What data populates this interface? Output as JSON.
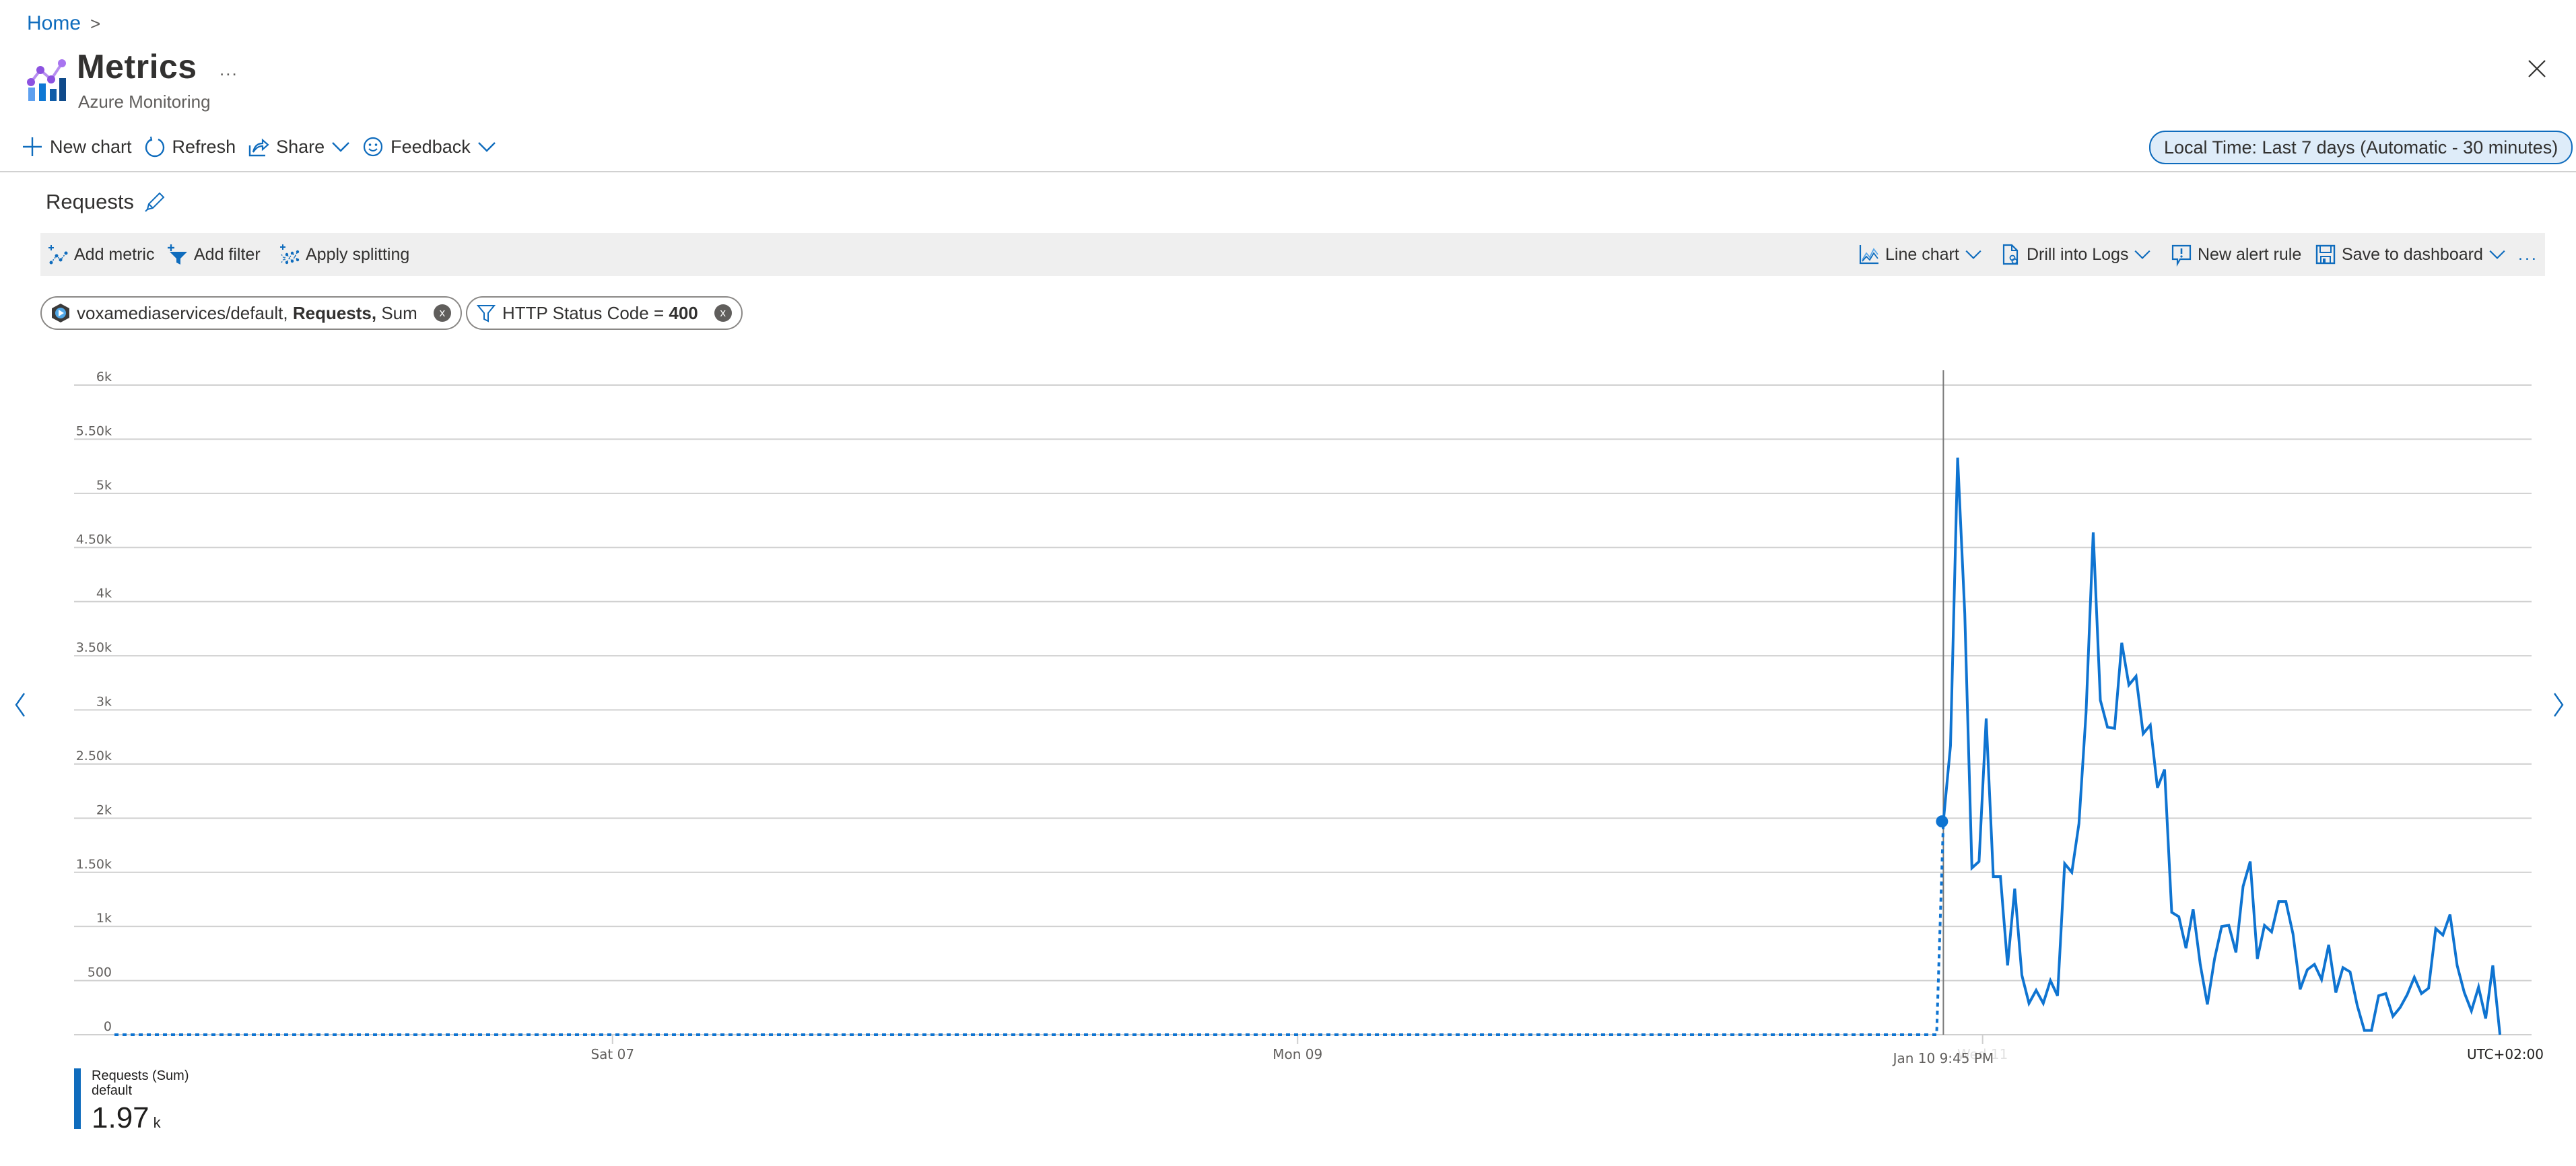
{
  "breadcrumb": {
    "items": [
      "Home"
    ],
    "separator": ">"
  },
  "header": {
    "title": "Metrics",
    "subtitle": "Azure Monitoring",
    "more_label": "...",
    "icon": "metrics-icon",
    "close_icon": "close-icon"
  },
  "toolbar": {
    "new_chart": "New chart",
    "refresh": "Refresh",
    "share": "Share",
    "feedback": "Feedback",
    "time_range": "Local Time: Last 7 days (Automatic - 30 minutes)"
  },
  "chart_panel": {
    "title": "Requests",
    "edit_icon": "pencil-icon",
    "actions_left": [
      "Add metric",
      "Add filter",
      "Apply splitting"
    ],
    "actions_right": [
      "Line chart",
      "Drill into Logs",
      "New alert rule",
      "Save to dashboard",
      "..."
    ],
    "chips": [
      {
        "resource": "voxamediaservices/default,",
        "metric": "Requests,",
        "aggregation": "Sum",
        "remove": "x"
      },
      {
        "label": "HTTP Status Code = ",
        "value": "400",
        "remove": "x"
      }
    ]
  },
  "legend": {
    "series_name": "Requests (Sum)",
    "series_sub": "default",
    "value": "1.97",
    "unit": "k",
    "color": "#0f6cbd"
  },
  "colors": {
    "accent": "#0f6cbd",
    "line": "#0f74d1",
    "grid": "#d0d0d0"
  },
  "chart_data": {
    "type": "line",
    "title": "Requests",
    "xlabel": "",
    "ylabel": "",
    "timezone_label": "UTC+02:00",
    "granularity_minutes": 30,
    "ylim": [
      0,
      6000
    ],
    "yticks": [
      0,
      500,
      1000,
      1500,
      2000,
      2500,
      3000,
      3500,
      4000,
      4500,
      5000,
      5500,
      6000
    ],
    "ytick_labels": [
      "0",
      "500",
      "1k",
      "1.50k",
      "2k",
      "2.50k",
      "3k",
      "3.50k",
      "4k",
      "4.50k",
      "5k",
      "5.50k",
      "6k"
    ],
    "xrange_hours_from_sat07": [
      -34.9,
      132.2
    ],
    "xticks": [
      {
        "label": "Sat 07",
        "hours_from_sat07": 0
      },
      {
        "label": "Mon 09",
        "hours_from_sat07": 48
      },
      {
        "label": "Wed 11",
        "hours_from_sat07": 96,
        "faded": true
      }
    ],
    "cursor": {
      "label": "Jan 10 9:45 PM",
      "hours_from_sat07": 93.25,
      "value": 1970
    },
    "grid": true,
    "legend_position": "bottom-left",
    "series": [
      {
        "name": "Requests (Sum) default",
        "missing_before_first_point": true,
        "start_hours_from_sat07": 93.25,
        "values": [
          1970,
          2670,
          5330,
          3890,
          1540,
          1600,
          2920,
          1460,
          1460,
          640,
          1350,
          550,
          290,
          410,
          290,
          500,
          360,
          1580,
          1500,
          1950,
          2980,
          4640,
          3090,
          2840,
          2830,
          3620,
          3230,
          3310,
          2780,
          2860,
          2280,
          2450,
          1130,
          1090,
          800,
          1160,
          650,
          280,
          700,
          1000,
          1010,
          760,
          1370,
          1600,
          700,
          1010,
          950,
          1230,
          1230,
          930,
          420,
          600,
          650,
          510,
          830,
          390,
          620,
          580,
          270,
          40,
          40,
          360,
          380,
          170,
          250,
          370,
          530,
          380,
          430,
          980,
          920,
          1110,
          640,
          390,
          220,
          440,
          150,
          640,
          0
        ]
      }
    ]
  }
}
